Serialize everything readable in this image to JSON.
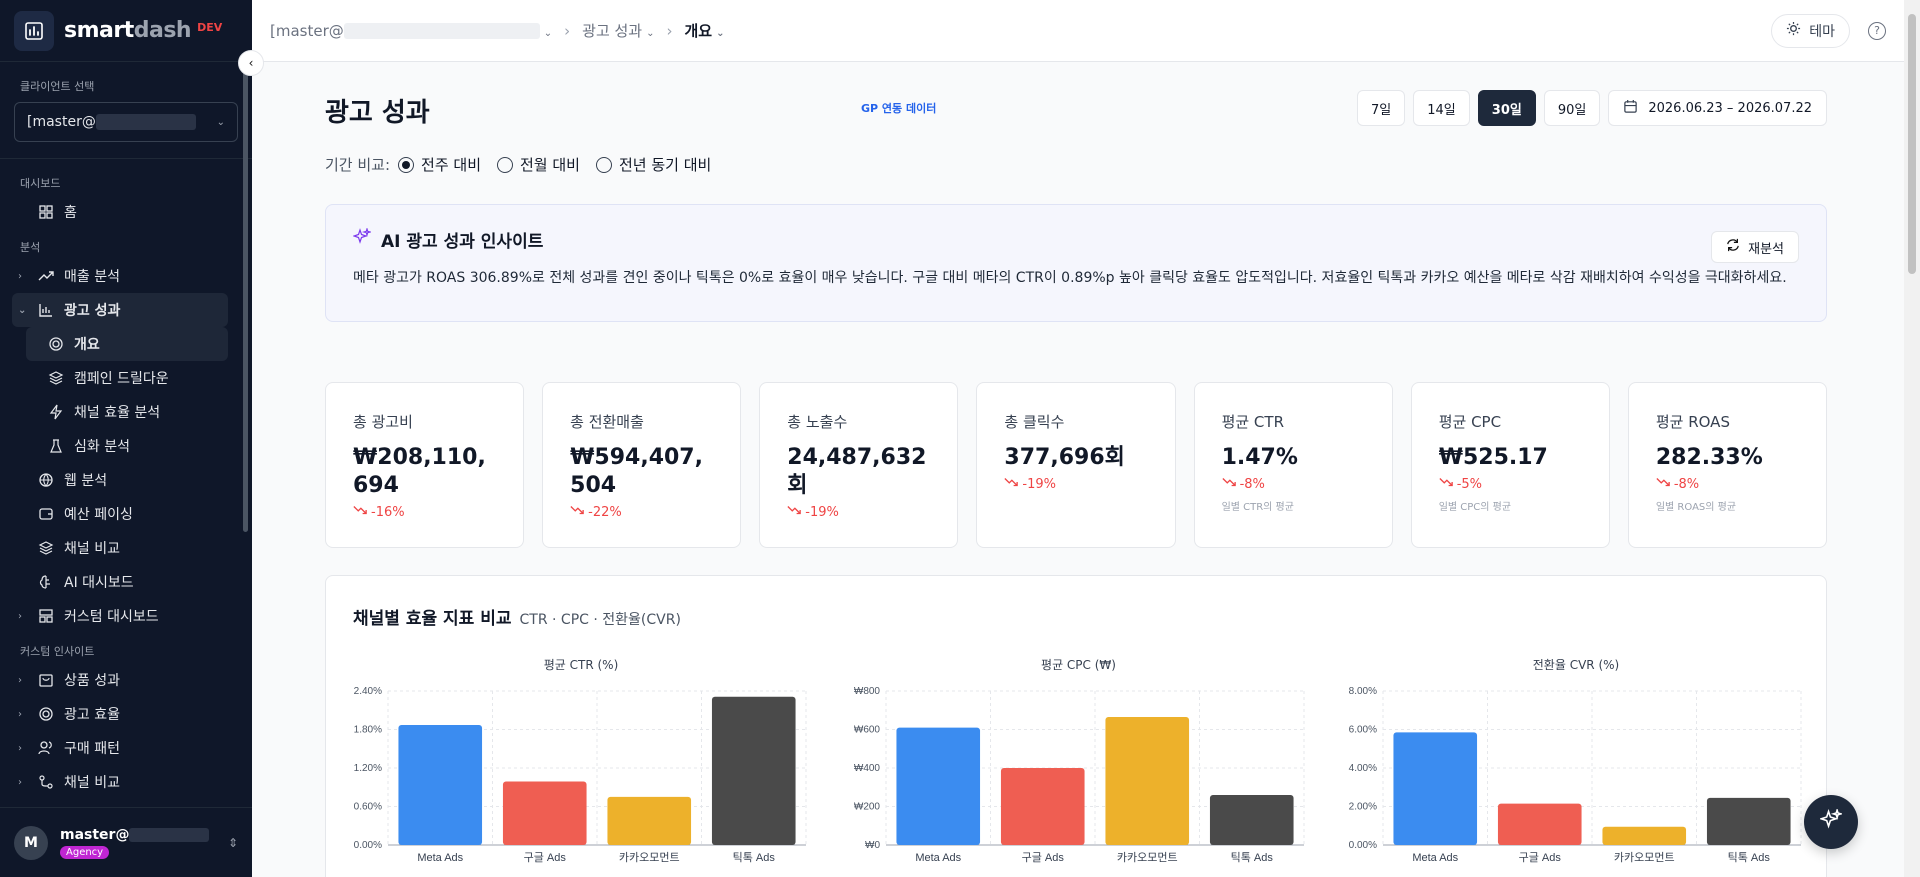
{
  "brand": {
    "name_dark": "smart",
    "name_light": "dash",
    "env": "DEV"
  },
  "sidebar": {
    "client_label": "클라이언트 선택",
    "client_value": "[master@",
    "sections": {
      "dashboard": "대시보드",
      "analysis": "분석",
      "custom": "커스텀 인사이트"
    },
    "home": "홈",
    "items": {
      "sales": "매출 분석",
      "ad": "광고 성과",
      "overview": "개요",
      "campaign": "캠페인 드릴다운",
      "channel_eff": "채널 효율 분석",
      "deep": "심화 분석",
      "web": "웹 분석",
      "budget": "예산 페이싱",
      "channel_cmp": "채널 비교",
      "ai_dash": "AI 대시보드",
      "custom_dash": "커스텀 대시보드",
      "product": "상품 성과",
      "ad_eff": "광고 효율",
      "purchase": "구매 패턴",
      "channel_cmp2": "채널 비교"
    },
    "user": {
      "initial": "M",
      "name": "master@",
      "role": "Agency"
    }
  },
  "topbar": {
    "crumb_client": "[master@",
    "crumb_section": "광고 성과",
    "crumb_page": "개요",
    "theme_label": "테마",
    "help": "?"
  },
  "page": {
    "title": "광고 성과",
    "gp_badge": "GP 연동 데이터",
    "ranges": [
      "7일",
      "14일",
      "30일",
      "90일"
    ],
    "active_range": "30일",
    "date_range": "2026.06.23 – 2026.07.22",
    "compare_label": "기간 비교:",
    "compare_options": [
      "전주 대비",
      "전월 대비",
      "전년 동기 대비"
    ]
  },
  "ai": {
    "title": "AI 광고 성과 인사이트",
    "button": "재분석",
    "text": "메타 광고가 ROAS 306.89%로 전체 성과를 견인 중이나 틱톡은 0%로 효율이 매우 낮습니다. 구글 대비 메타의 CTR이 0.89%p 높아 클릭당 효율도 압도적입니다. 저효율인 틱톡과 카카오 예산을 메타로 삭감 재배치하여 수익성을 극대화하세요."
  },
  "kpis": [
    {
      "label": "총 광고비",
      "value": "₩208,110,694",
      "change": "-16%",
      "note": ""
    },
    {
      "label": "총 전환매출",
      "value": "₩594,407,504",
      "change": "-22%",
      "note": ""
    },
    {
      "label": "총 노출수",
      "value": "24,487,632회",
      "change": "-19%",
      "note": ""
    },
    {
      "label": "총 클릭수",
      "value": "377,696회",
      "change": "-19%",
      "note": ""
    },
    {
      "label": "평균 CTR",
      "value": "1.47%",
      "change": "-8%",
      "note": "일별 CTR의 평균"
    },
    {
      "label": "평균 CPC",
      "value": "₩525.17",
      "change": "-5%",
      "note": "일별 CPC의 평균"
    },
    {
      "label": "평균 ROAS",
      "value": "282.33%",
      "change": "-8%",
      "note": "일별 ROAS의 평균"
    }
  ],
  "chart_section": {
    "title": "채널별 효율 지표 비교",
    "subtitle": "CTR · CPC · 전환율(CVR)"
  },
  "chart_data": [
    {
      "type": "bar",
      "title": "평균 CTR (%)",
      "categories": [
        "Meta Ads",
        "구글 Ads",
        "카카오모먼트",
        "틱톡 Ads"
      ],
      "values": [
        1.87,
        0.99,
        0.75,
        2.31
      ],
      "ylim": [
        0,
        2.4
      ],
      "ticks": [
        "0.00%",
        "0.60%",
        "1.20%",
        "1.80%",
        "2.40%"
      ],
      "tick_values": [
        0,
        0.6,
        1.2,
        1.8,
        2.4
      ],
      "colors": [
        "#3b8cf0",
        "#ef5e52",
        "#edb12b",
        "#4a4a4a"
      ],
      "grid": true
    },
    {
      "type": "bar",
      "title": "평균 CPC (₩)",
      "categories": [
        "Meta Ads",
        "구글 Ads",
        "카카오모먼트",
        "틱톡 Ads"
      ],
      "values": [
        610,
        400,
        665,
        260
      ],
      "ylim": [
        0,
        800
      ],
      "ticks": [
        "₩0",
        "₩200",
        "₩400",
        "₩600",
        "₩800"
      ],
      "tick_values": [
        0,
        200,
        400,
        600,
        800
      ],
      "colors": [
        "#3b8cf0",
        "#ef5e52",
        "#edb12b",
        "#4a4a4a"
      ],
      "grid": true
    },
    {
      "type": "bar",
      "title": "전환율 CVR (%)",
      "categories": [
        "Meta Ads",
        "구글 Ads",
        "카카오모먼트",
        "틱톡 Ads"
      ],
      "values": [
        5.85,
        2.15,
        0.95,
        2.45
      ],
      "ylim": [
        0,
        8
      ],
      "ticks": [
        "0.00%",
        "2.00%",
        "4.00%",
        "6.00%",
        "8.00%"
      ],
      "tick_values": [
        0,
        2,
        4,
        6,
        8
      ],
      "colors": [
        "#3b8cf0",
        "#ef5e52",
        "#edb12b",
        "#4a4a4a"
      ],
      "grid": true
    }
  ]
}
